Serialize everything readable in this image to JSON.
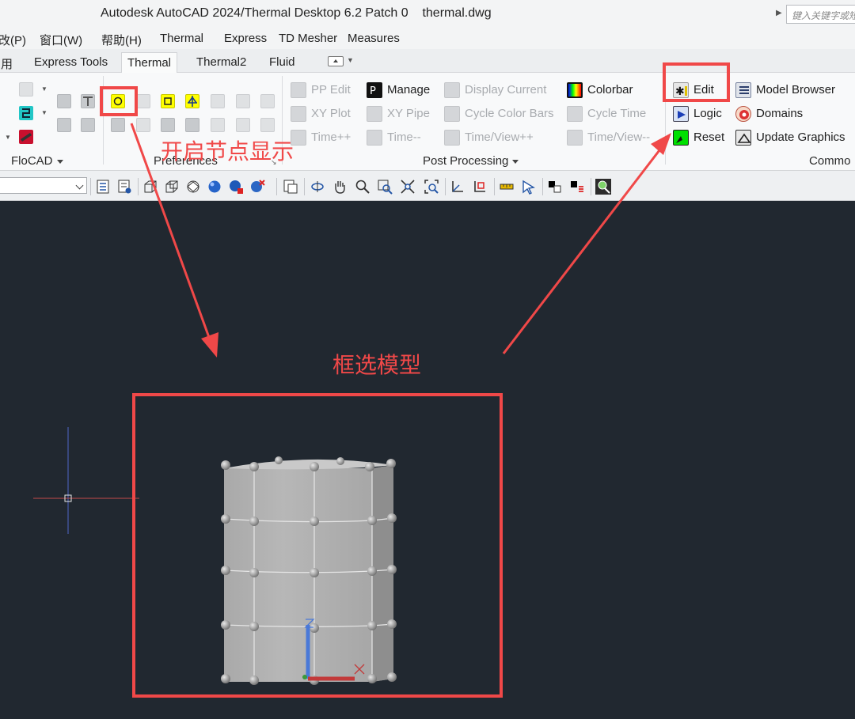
{
  "window": {
    "title": "Autodesk AutoCAD 2024/Thermal Desktop 6.2 Patch 0    thermal.dwg",
    "search_placeholder": "键入关键字或短语"
  },
  "menubar": {
    "items": [
      "改(P)",
      "窗口(W)",
      "帮助(H)",
      "Thermal",
      "Express",
      "TD Mesher",
      "Measures"
    ]
  },
  "ribbon_tabs": {
    "items": [
      "用",
      "Express Tools",
      "Thermal",
      "Thermal2",
      "Fluid"
    ],
    "active": "Thermal"
  },
  "ribbon": {
    "groups": {
      "flocad": "FloCAD",
      "preferences": "Preferences",
      "post_processing": "Post Processing",
      "common": "Commo"
    },
    "post_processing": {
      "pp_edit": "PP Edit",
      "manage": "Manage",
      "display_current": "Display Current",
      "colorbar": "Colorbar",
      "xy_plot": "XY Plot",
      "xy_pipe": "XY Pipe",
      "cycle_color_bars": "Cycle Color Bars",
      "cycle_time": "Cycle Time",
      "time_plus": "Time++",
      "time_minus": "Time--",
      "time_view_plus": "Time/View++",
      "time_view_minus": "Time/View--"
    },
    "common": {
      "edit": "Edit",
      "model_browser": "Model Browser",
      "logic": "Logic",
      "domains": "Domains",
      "reset": "Reset",
      "update_graphics": "Update Graphics"
    }
  },
  "annotations": {
    "node_display": "开启节点显示",
    "box_select": "框选模型",
    "color": "#f04848"
  },
  "colors": {
    "canvas_bg": "#212830",
    "annotation_red": "#f04848",
    "highlight_yellow": "#ffff00"
  }
}
